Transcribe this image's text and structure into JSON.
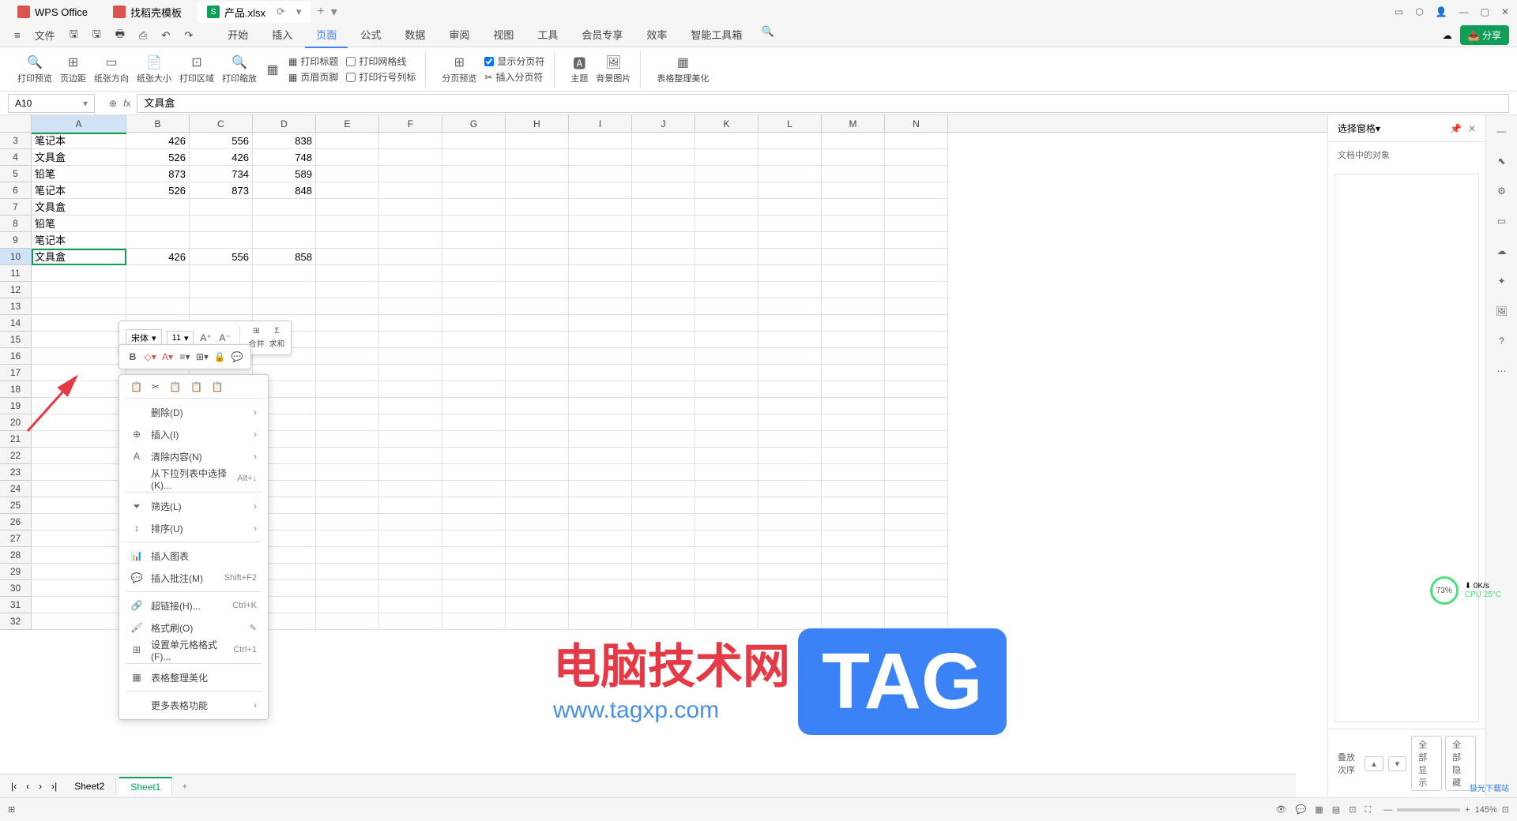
{
  "titlebar": {
    "app_name": "WPS Office",
    "tab1": "找稻壳模板",
    "tab2": "产品.xlsx",
    "tab2_badge": "S"
  },
  "menubar": {
    "file": "文件",
    "tabs": [
      "开始",
      "插入",
      "页面",
      "公式",
      "数据",
      "审阅",
      "视图",
      "工具",
      "会员专享",
      "效率",
      "智能工具箱"
    ],
    "active_tab": "页面",
    "share": "分享"
  },
  "ribbon": {
    "print_preview": "打印预览",
    "margins": "页边距",
    "orientation": "纸张方向",
    "size": "纸张大小",
    "print_area": "打印区域",
    "print_scale": "打印缩放",
    "print_header": "打印标题",
    "header_footer": "页眉页脚",
    "grid_print": "打印网格线",
    "row_label": "打印行号列标",
    "page_break_preview": "分页预览",
    "insert_page_break": "插入分页符",
    "show_page_break": "显示分页符",
    "theme": "主题",
    "bg_image": "背景图片",
    "table_style": "表格整理美化"
  },
  "formula": {
    "cell_ref": "A10",
    "value": "文具盒"
  },
  "columns": [
    "A",
    "B",
    "C",
    "D",
    "E",
    "F",
    "G",
    "H",
    "I",
    "J",
    "K",
    "L",
    "M",
    "N"
  ],
  "rows_start": 3,
  "data": [
    {
      "r": 3,
      "a": "笔记本",
      "b": 426,
      "c": 556,
      "d": 838
    },
    {
      "r": 4,
      "a": "文具盒",
      "b": 526,
      "c": 426,
      "d": 748
    },
    {
      "r": 5,
      "a": "铅笔",
      "b": 873,
      "c": 734,
      "d": 589
    },
    {
      "r": 6,
      "a": "笔记本",
      "b": 526,
      "c": 873,
      "d": 848
    },
    {
      "r": 7,
      "a": "文具盒",
      "b": "",
      "c": "",
      "d": ""
    },
    {
      "r": 8,
      "a": "铅笔",
      "b": "",
      "c": "",
      "d": ""
    },
    {
      "r": 9,
      "a": "笔记本",
      "b": "",
      "c": "",
      "d": ""
    },
    {
      "r": 10,
      "a": "文具盒",
      "b": 426,
      "c": 556,
      "d": 858
    }
  ],
  "mini_toolbar": {
    "font": "宋体",
    "size": "11",
    "merge": "合并",
    "sum": "求和"
  },
  "context_menu": {
    "delete": "删除(D)",
    "insert": "插入(I)",
    "clear": "清除内容(N)",
    "dropdown": "从下拉列表中选择(K)...",
    "dropdown_key": "Alt+↓",
    "filter": "筛选(L)",
    "sort": "排序(U)",
    "insert_chart": "插入图表",
    "insert_comment": "插入批注(M)",
    "comment_key": "Shift+F2",
    "hyperlink": "超链接(H)...",
    "hyperlink_key": "Ctrl+K",
    "format_painter": "格式刷(O)",
    "cell_format": "设置单元格格式(F)...",
    "cell_format_key": "Ctrl+1",
    "table_beautify": "表格整理美化",
    "more": "更多表格功能"
  },
  "right_panel": {
    "title": "选择窗格",
    "subtitle": "文档中的对象",
    "stack_order": "叠放次序",
    "show_all": "全部显示",
    "hide_all": "全部隐藏"
  },
  "sheets": {
    "sheet2": "Sheet2",
    "sheet1": "Sheet1"
  },
  "status": {
    "zoom": "145%"
  },
  "cpu_widget": {
    "percent": "73%",
    "speed": "0K/s",
    "temp": "CPU 25°C"
  },
  "watermark": {
    "text": "电脑技术网",
    "url": "www.tagxp.com",
    "tag": "TAG",
    "dl": "极光下载站"
  }
}
